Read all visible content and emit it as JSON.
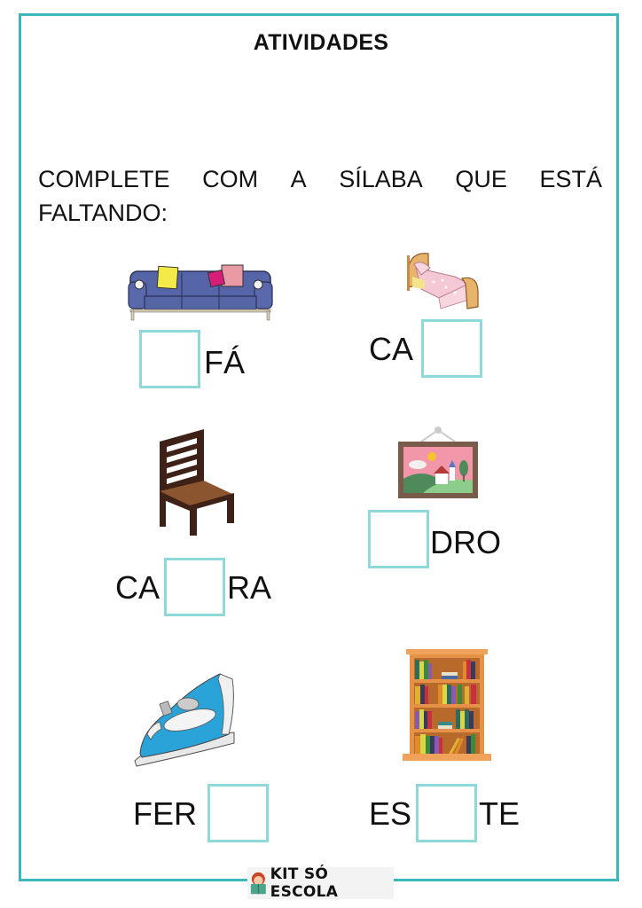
{
  "title": "ATIVIDADES",
  "instruction": {
    "line1_words": [
      "COMPLETE",
      "COM",
      "A",
      "SÍLABA",
      "QUE",
      "ESTÁ"
    ],
    "line2": "FALTANDO:"
  },
  "exercises": [
    {
      "picture": "sofa-icon",
      "before": "",
      "after": "FÁ",
      "answer": ""
    },
    {
      "picture": "bed-icon",
      "before": "CA",
      "after": "",
      "answer": ""
    },
    {
      "picture": "chair-icon",
      "before": "CA",
      "after": "RA",
      "answer": ""
    },
    {
      "picture": "framed-picture-icon",
      "before": "",
      "after": "DRO",
      "answer": ""
    },
    {
      "picture": "clothes-iron-icon",
      "before": "FER",
      "after": "",
      "answer": ""
    },
    {
      "picture": "bookshelf-icon",
      "before": "ES",
      "after": "TE",
      "answer": ""
    }
  ],
  "footer": {
    "brand": "KIT SÓ ESCOLA",
    "logo_icon": "reading-child-icon"
  },
  "colors": {
    "frame": "#3bb8bb",
    "answer_box": "#8fd9db"
  }
}
